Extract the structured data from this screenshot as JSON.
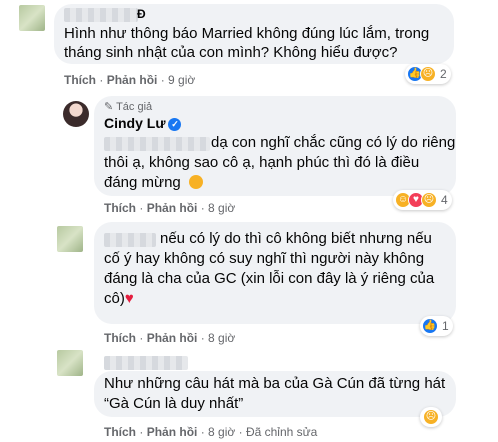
{
  "comments": [
    {
      "author_suffix": "Đ",
      "text_lines": [
        "Hình như thông báo Married không đúng lúc lắm, trong",
        "tháng sinh nhật của con mình? Không hiểu được?"
      ],
      "like_label": "Thích",
      "reply_label": "Phản hồi",
      "time": "9 giờ",
      "reaction_count": "2"
    },
    {
      "author_tag": "Tác giả",
      "author_name": "Cindy Lư",
      "text_lines": [
        "dạ con nghĩ chắc cũng có lý do riêng",
        "thôi ạ, không sao cô ạ, hạnh phúc thì đó là điều",
        "đáng mừng"
      ],
      "like_label": "Thích",
      "reply_label": "Phản hồi",
      "time": "8 giờ",
      "reaction_count": "4"
    },
    {
      "text_lines": [
        "nếu có lý do thì cô không biết nhưng nếu",
        "cố ý hay không có suy nghĩ thì người này không",
        "đáng là cha của GC (xin lỗi con đây là ý riêng của",
        "cô)"
      ],
      "like_label": "Thích",
      "reply_label": "Phản hồi",
      "time": "8 giờ",
      "reaction_count": "1"
    },
    {
      "text_lines": [
        "Như những câu hát mà ba của Gà Cún đã từng hát",
        "“Gà Cún là duy nhất”"
      ],
      "like_label": "Thích",
      "reply_label": "Phản hồi",
      "time": "8 giờ",
      "edited_label": "Đã chỉnh sửa"
    }
  ],
  "separator": "·",
  "colors": {
    "bubble": "#f0f2f5",
    "meta": "#65676b",
    "like": "#1877f2",
    "sad": "#f7b125",
    "heart": "#e41e3f"
  }
}
